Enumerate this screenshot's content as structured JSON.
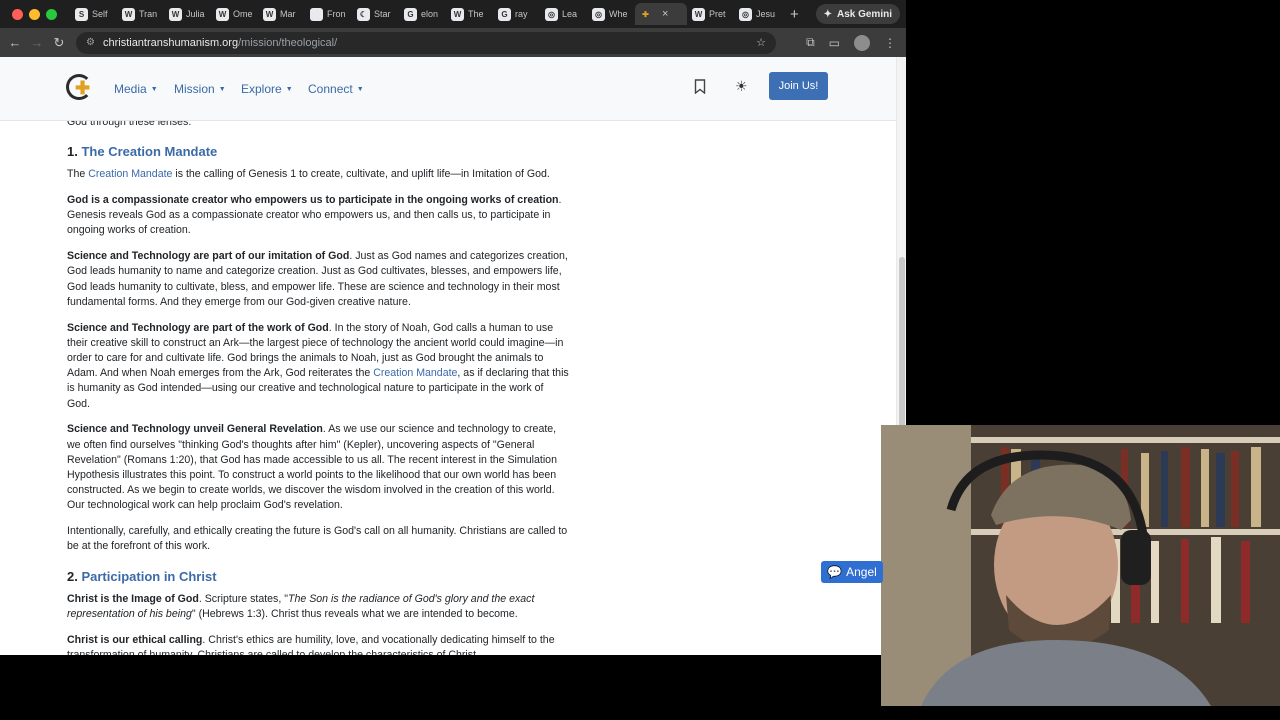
{
  "browser": {
    "tabs": [
      {
        "label": "Self",
        "icon": "S"
      },
      {
        "label": "Tran",
        "icon": "W"
      },
      {
        "label": "Julia",
        "icon": "W"
      },
      {
        "label": "Ome",
        "icon": "W"
      },
      {
        "label": "Mar",
        "icon": "W"
      },
      {
        "label": "Fron",
        "icon": ""
      },
      {
        "label": "Star",
        "icon": "☾"
      },
      {
        "label": "elon",
        "icon": "G"
      },
      {
        "label": "The",
        "icon": "W"
      },
      {
        "label": "ray",
        "icon": "G"
      },
      {
        "label": "Lea",
        "icon": "◎"
      },
      {
        "label": "Whe",
        "icon": "◎"
      },
      {
        "label": "",
        "icon": "✚"
      },
      {
        "label": "Pret",
        "icon": "W"
      },
      {
        "label": "Jesu",
        "icon": "◎"
      }
    ],
    "new_tab": "+",
    "gemini_label": "Ask Gemini",
    "url_host": "christiantranshumanism.org",
    "url_path": "/mission/theological/"
  },
  "site_nav": {
    "items": [
      "Media",
      "Mission",
      "Explore",
      "Connect"
    ],
    "join_label": "Join Us!"
  },
  "article": {
    "intro_tail": "God through these lenses:",
    "s1_num": "1.",
    "s1_title": "The Creation Mandate",
    "p1_a": "The ",
    "p1_link": "Creation Mandate",
    "p1_b": " is the calling of Genesis 1 to create, cultivate, and uplift life—in Imitation of God.",
    "p2_bold": "God is a compassionate creator who empowers us to participate in the ongoing works of creation",
    "p2_text": ". Genesis reveals God as a compassionate creator who empowers us, and then calls us, to participate in ongoing works of creation.",
    "p3_bold": "Science and Technology are part of our imitation of God",
    "p3_text": ". Just as God names and categorizes creation, God leads humanity to name and categorize creation. Just as God cultivates, blesses, and empowers life, God leads humanity to cultivate, bless, and empower life. These are science and technology in their most fundamental forms. And they emerge from our God-given creative nature.",
    "p4_bold": "Science and Technology are part of the work of God",
    "p4_text_a": ". In the story of Noah, God calls a human to use their creative skill to construct an Ark—the largest piece of technology the ancient world could imagine—in order to care for and cultivate life. God brings the animals to Noah, just as God brought the animals to Adam. And when Noah emerges from the Ark, God reiterates the ",
    "p4_link": "Creation Mandate",
    "p4_text_b": ", as if declaring that this is humanity as God intended—using our creative and technological nature to participate in the work of God.",
    "p5_bold": "Science and Technology unveil General Revelation",
    "p5_text": ". As we use our science and technology to create, we often find ourselves \"thinking God's thoughts after him\" (Kepler), uncovering aspects of \"General Revelation\" (Romans 1:20), that God has made accessible to us all. The recent interest in the Simulation Hypothesis illustrates this point. To construct a world points to the likelihood that our own world has been constructed. As we begin to create worlds, we discover the wisdom involved in the creation of this world. Our technological work can help proclaim God's revelation.",
    "p6": "Intentionally, carefully, and ethically creating the future is God's call on all humanity. Christians are called to be at the forefront of this work.",
    "s2_num": "2.",
    "s2_title": "Participation in Christ",
    "p7_bold": "Christ is the Image of God",
    "p7_a": ". Scripture states, \"",
    "p7_italic": "The Son is the radiance of God's glory and the exact representation of his being",
    "p7_b": "\" (Hebrews 1:3). Christ thus reveals what we are intended to become.",
    "p8_bold": "Christ is our ethical calling",
    "p8_text": ". Christ's ethics are humility, love, and vocationally dedicating himself to the transformation of humanity. Christians are called to develop the characteristics of Christ."
  },
  "angel_label": "Angel",
  "colors": {
    "link": "#3a6aa8",
    "join_button": "#3d6fb5",
    "angel_button": "#2f6fd1"
  }
}
